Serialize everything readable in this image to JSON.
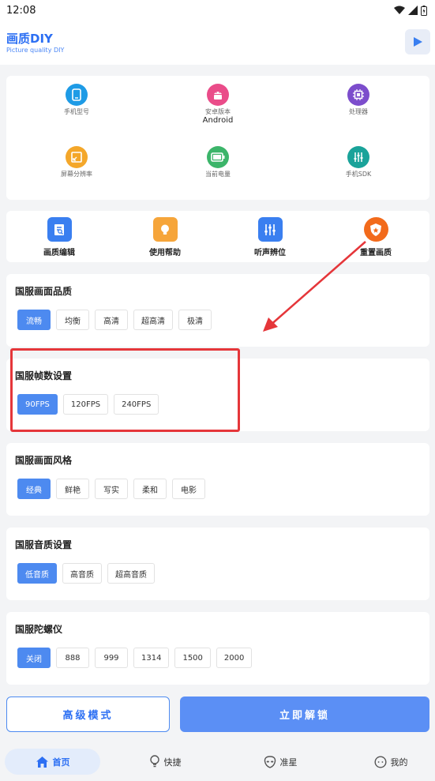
{
  "status": {
    "time": "12:08"
  },
  "app": {
    "title": "画质DIY",
    "subtitle": "Picture quality DIY"
  },
  "info": [
    {
      "label": "手机型号",
      "value": "",
      "icon": "phone-icon",
      "color": "#1e9be6"
    },
    {
      "label": "安卓版本",
      "value": "Android",
      "icon": "android-icon",
      "color": "#ea4c89"
    },
    {
      "label": "处理器",
      "value": "",
      "icon": "cpu-icon",
      "color": "#7c4dcc"
    },
    {
      "label": "屏幕分辨率",
      "value": "",
      "icon": "screen-icon",
      "color": "#f4a72a"
    },
    {
      "label": "当前电量",
      "value": "",
      "icon": "battery-icon",
      "color": "#3cb56a"
    },
    {
      "label": "手机SDK",
      "value": "",
      "icon": "sdk-icon",
      "color": "#1aa39a"
    }
  ],
  "tools": [
    {
      "label": "画质编辑",
      "icon": "edit-icon",
      "color": "#3a7ff0"
    },
    {
      "label": "使用帮助",
      "icon": "bulb-icon",
      "color": "#f6a53a"
    },
    {
      "label": "听声辨位",
      "icon": "sliders-icon",
      "color": "#3a7ff0"
    },
    {
      "label": "重置画质",
      "icon": "shield-icon",
      "color": "#f26a1b"
    }
  ],
  "sections": [
    {
      "title": "国服画面品质",
      "options": [
        "流畅",
        "均衡",
        "高清",
        "超高清",
        "极清"
      ],
      "selected": 0
    },
    {
      "title": "国服帧数设置",
      "options": [
        "90FPS",
        "120FPS",
        "240FPS"
      ],
      "selected": 0
    },
    {
      "title": "国服画面风格",
      "options": [
        "经典",
        "鲜艳",
        "写实",
        "柔和",
        "电影"
      ],
      "selected": 0
    },
    {
      "title": "国服音质设置",
      "options": [
        "低音质",
        "高音质",
        "超高音质"
      ],
      "selected": 0
    },
    {
      "title": "国服陀螺仪",
      "options": [
        "关闭",
        "888",
        "999",
        "1314",
        "1500",
        "2000"
      ],
      "selected": 0
    }
  ],
  "actions": {
    "advanced": "高级模式",
    "unlock": "立即解锁"
  },
  "nav": [
    {
      "label": "首页",
      "icon": "home-icon",
      "active": true
    },
    {
      "label": "快捷",
      "icon": "bulb-icon",
      "active": false
    },
    {
      "label": "准星",
      "icon": "alien-icon",
      "active": false
    },
    {
      "label": "我的",
      "icon": "face-icon",
      "active": false
    }
  ],
  "colors": {
    "accent": "#4d8af0",
    "highlight": "#e5363a"
  }
}
